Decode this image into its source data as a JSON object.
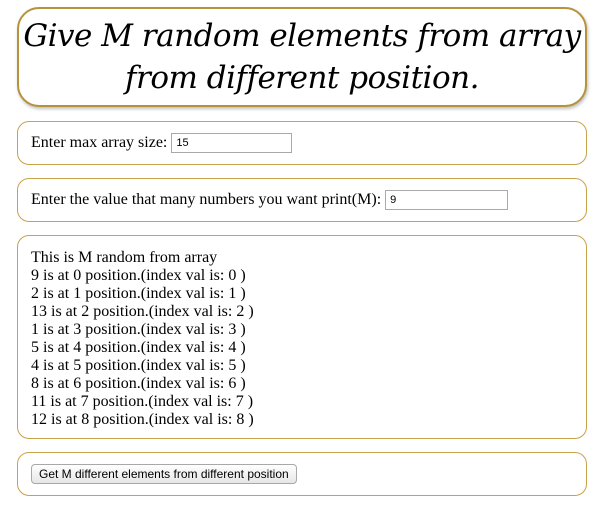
{
  "title": {
    "line1": "Give M random elements from array",
    "line2": "from different position."
  },
  "size_row": {
    "label": "Enter max array size:",
    "value": "15"
  },
  "m_row": {
    "label": "Enter the value that many numbers you want print(M):",
    "value": "9"
  },
  "results": {
    "heading": "This is M random from array",
    "lines": [
      "9 is at 0 position.(index val is: 0 )",
      "2 is at 1 position.(index val is: 1 )",
      "13 is at 2 position.(index val is: 2 )",
      "1 is at 3 position.(index val is: 3 )",
      "5 is at 4 position.(index val is: 4 )",
      "4 is at 5 position.(index val is: 5 )",
      "8 is at 6 position.(index val is: 6 )",
      "11 is at 7 position.(index val is: 7 )",
      "12 is at 8 position.(index val is: 8 )"
    ]
  },
  "action": {
    "button_label": "Get M different elements from different position"
  },
  "colors": {
    "border": "#c9a14a",
    "title_border": "#b8923a"
  }
}
